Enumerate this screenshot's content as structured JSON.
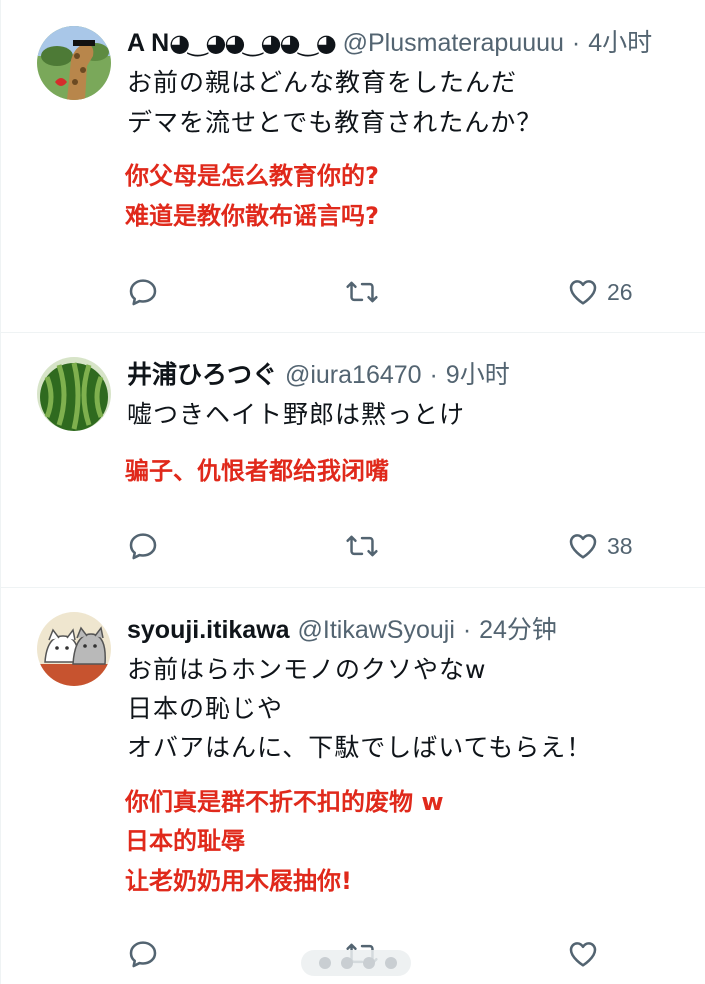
{
  "tweets": [
    {
      "display_name": "A N",
      "handle": "@Plusmaterapuuuu",
      "time": "4小时",
      "lines": [
        "お前の親はどんな教育をしたんだ",
        "デマを流せとでも教育されたんか？"
      ],
      "translation": [
        "你父母是怎么教育你的?",
        "难道是教你散布谣言吗?"
      ],
      "reply_count": "",
      "retweet_count": "",
      "like_count": "26",
      "avatar_icon": "giraffe-avatar"
    },
    {
      "display_name": "井浦ひろつぐ",
      "handle": "@iura16470",
      "time": "9小时",
      "lines": [
        "嘘つきヘイト野郎は黙っとけ"
      ],
      "translation": [
        "骗子、仇恨者都给我闭嘴"
      ],
      "reply_count": "",
      "retweet_count": "",
      "like_count": "38",
      "avatar_icon": "watermelon-avatar"
    },
    {
      "display_name": "syouji.itikawa",
      "handle": "@ItikawSyouji",
      "time": "24分钟",
      "lines": [
        "お前はらホンモノのクソやなw",
        "日本の恥じや",
        "オバアはんに、下駄でしばいてもらえ！"
      ],
      "translation": [
        "你们真是群不折不扣的废物 w",
        "日本的耻辱",
        "让老奶奶用木屐抽你!"
      ],
      "reply_count": "",
      "retweet_count": "",
      "like_count": "",
      "avatar_icon": "cats-illustration-avatar"
    }
  ],
  "separator": "·",
  "icons": {
    "reply": "reply-icon",
    "retweet": "retweet-icon",
    "like": "heart-icon"
  },
  "colors": {
    "translation": "#e0291b",
    "meta": "#536471",
    "text": "#0f1419",
    "divider": "#eff3f4"
  }
}
